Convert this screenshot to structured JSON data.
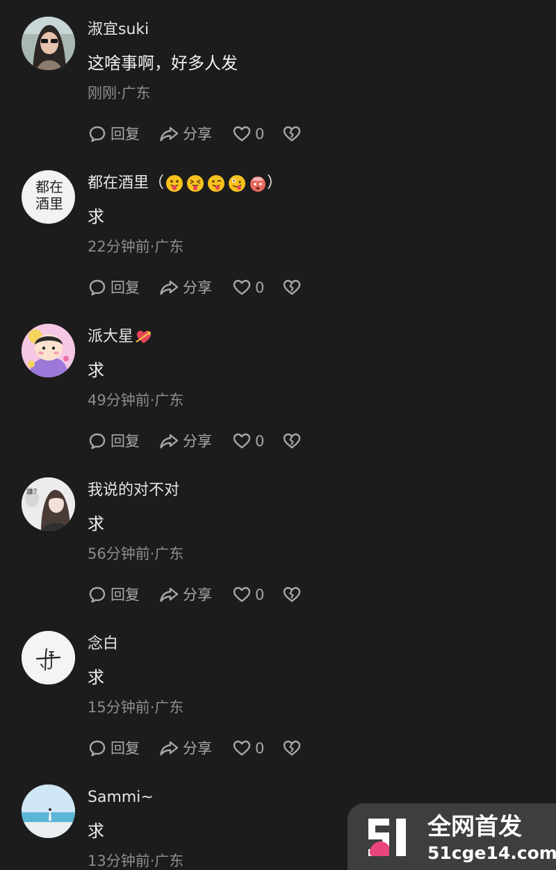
{
  "comments": [
    {
      "username": "淑宜suki",
      "text": "这啥事啊，好多人发",
      "meta": "刚刚·广东",
      "reply_label": "回复",
      "share_label": "分享",
      "likes": "0",
      "avatar_icon": "portrait-woman-sunglasses"
    },
    {
      "username": "都在酒里（",
      "username_suffix": "）",
      "avatar_text": "都在酒里",
      "emojis": [
        "tongue-face-emoji",
        "squinting-tongue-emoji",
        "winking-tongue-emoji",
        "zany-face-emoji",
        "exploding-head-emoji"
      ],
      "text": "求",
      "meta": "22分钟前·广东",
      "reply_label": "回复",
      "share_label": "分享",
      "likes": "0"
    },
    {
      "username": "派大星",
      "username_emoji": "heart-with-arrow-emoji",
      "text": "求",
      "meta": "49分钟前·广东",
      "reply_label": "回复",
      "share_label": "分享",
      "likes": "0",
      "avatar_icon": "cartoon-girl"
    },
    {
      "username": "我说的对不对",
      "avatar_text": "誰？",
      "text": "求",
      "meta": "56分钟前·广东",
      "reply_label": "回复",
      "share_label": "分享",
      "likes": "0"
    },
    {
      "username": "念白",
      "text": "求",
      "meta": "15分钟前·广东",
      "reply_label": "回复",
      "share_label": "分享",
      "likes": "0",
      "avatar_icon": "calligraphy-mark"
    },
    {
      "username": "Sammi~",
      "text": "求",
      "meta": "13分钟前·广东",
      "avatar_icon": "beach-scene"
    }
  ],
  "watermark": {
    "title": "全网首发",
    "domain": "51cge14.com"
  },
  "colors": {
    "background": "#1c1c1c",
    "text_primary": "#e6e6e6",
    "text_secondary": "#8d8d8d",
    "action": "#a8a8a8",
    "watermark_accent": "#e9457c"
  }
}
